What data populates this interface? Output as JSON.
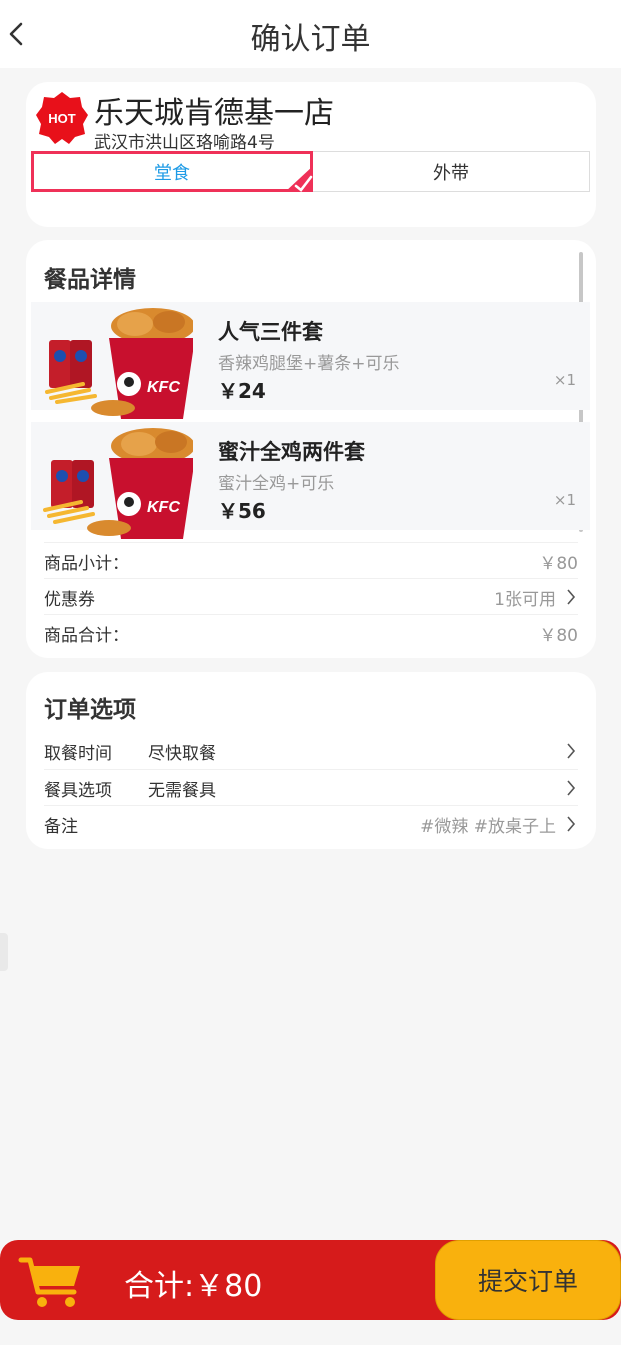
{
  "header": {
    "title": "确认订单"
  },
  "store": {
    "badge": "HOT",
    "name": "乐天城肯德基一店",
    "address": "武汉市洪山区珞喻路4号",
    "tabs": [
      {
        "label": "堂食",
        "active": true
      },
      {
        "label": "外带",
        "active": false
      }
    ]
  },
  "detail": {
    "title": "餐品详情",
    "items": [
      {
        "name": "人气三件套",
        "desc": "香辣鸡腿堡+薯条+可乐",
        "price": "￥24",
        "qty": "×1"
      },
      {
        "name": "蜜汁全鸡两件套",
        "desc": "蜜汁全鸡+可乐",
        "price": "￥56",
        "qty": "×1"
      }
    ],
    "subtotal": {
      "label": "商品小计：",
      "value": "￥80"
    },
    "coupon": {
      "label": "优惠券",
      "value": "1张可用"
    },
    "total": {
      "label": "商品合计：",
      "value": "￥80"
    }
  },
  "options": {
    "title": "订单选项",
    "pickup": {
      "label": "取餐时间",
      "value": "尽快取餐"
    },
    "tableware": {
      "label": "餐具选项",
      "value": "无需餐具"
    },
    "remark": {
      "label": "备注",
      "value": "#微辣 #放桌子上"
    }
  },
  "footer": {
    "total_label": "合计:￥80",
    "submit_label": "提交订单"
  },
  "colors": {
    "accent_red": "#d61b1b",
    "submit_yellow": "#f9b10d",
    "tab_border": "#ef3158",
    "tab_text": "#1e9be6"
  },
  "icons": {
    "back": "chevron-left-icon",
    "cart": "shopping-cart-icon",
    "arrow": "chevron-right-icon"
  }
}
